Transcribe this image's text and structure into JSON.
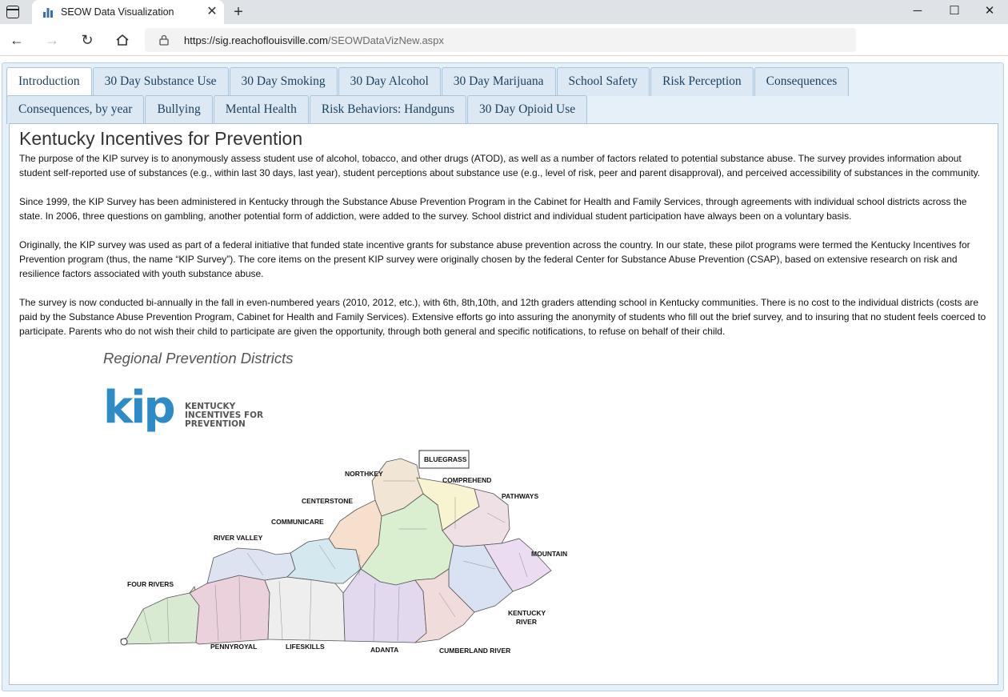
{
  "browser": {
    "tab_title": "SEOW Data Visualization",
    "url_host": "https://sig.reachoflouisville.com",
    "url_path": "/SEOWDataVizNew.aspx"
  },
  "nav": {
    "row1": [
      "Introduction",
      "30 Day Substance Use",
      "30 Day Smoking",
      "30 Day Alcohol",
      "30 Day Marijuana",
      "School Safety",
      "Risk Perception",
      "Consequences"
    ],
    "row2": [
      "Consequences, by year",
      "Bullying",
      "Mental Health",
      "Risk Behaviors: Handguns",
      "30 Day Opioid Use"
    ],
    "active": "Introduction"
  },
  "content": {
    "title": "Kentucky Incentives for Prevention",
    "paragraphs": [
      "The purpose of the KIP survey is to anonymously assess student use of alcohol, tobacco, and other drugs (ATOD), as well as a number of factors related to potential substance abuse. The survey provides information about student self-reported use of substances (e.g., within last 30 days, last year), student perceptions about substance use (e.g., level of risk, peer and parent disapproval), and perceived accessibility of substances in the community.",
      "Since 1999, the KIP Survey has been administered in Kentucky through the Substance Abuse Prevention Program in the Cabinet for Health and Family Services, through agreements with individual school districts across the state. In 2006, three questions on gambling, another potential form of addiction, were added to the survey. School district and individual student participation have always been on a voluntary basis.",
      "Originally, the KIP survey was used as part of a federal initiative that funded state incentive grants for substance abuse prevention across the country. In our state, these pilot programs were termed the Kentucky Incentives for Prevention program (thus, the name “KIP Survey”). The core items on the present KIP survey were originally chosen by the federal Center for Substance Abuse Prevention (CSAP), based on extensive research on risk and resilience factors associated with youth substance abuse.",
      "The survey is now conducted bi-annually in the fall in even-numbered years (2010, 2012, etc.), with 6th, 8th,10th, and 12th graders attending school in Kentucky communities. There is no cost to the individual districts (costs are paid by the Substance Abuse Prevention Program, Cabinet for Health and Family Services). Extensive efforts go into assuring the anonymity of students who fill out the brief survey, and to insuring that no student feels coerced to participate. Parents who do not wish their child to participate are given the opportunity, through both general and specific notifications, to refuse on behalf of their child."
    ]
  },
  "map": {
    "heading": "Regional Prevention Districts",
    "logo_letters": "kip",
    "logo_words": [
      "KENTUCKY",
      "INCENTIVES FOR",
      "PREVENTION"
    ],
    "regions": [
      "BLUEGRASS",
      "NORTHKEY",
      "COMPREHEND",
      "CENTERSTONE",
      "PATHWAYS",
      "COMMUNICARE",
      "RIVER VALLEY",
      "MOUNTAIN",
      "FOUR RIVERS",
      "KENTUCKY",
      "RIVER",
      "PENNYROYAL",
      "LIFESKILLS",
      "ADANTA",
      "CUMBERLAND RIVER"
    ],
    "colors": {
      "fourrivers": "#d9ead3",
      "pennyroyal": "#ead1dc",
      "rivervalley": "#dde3f0",
      "lifeskills": "#eeeeee",
      "communicare": "#d4e8f0",
      "centerstone": "#f6dfcc",
      "northkey": "#f1e6d6",
      "bluegrass": "#d9efcf",
      "comprehend": "#f8f4d2",
      "pathways": "#efe0e6",
      "adanta": "#e2d9ee",
      "cumberland": "#f1dcdc",
      "kentuckyriver": "#d8e2f3",
      "mountain": "#ecdcf2"
    }
  }
}
